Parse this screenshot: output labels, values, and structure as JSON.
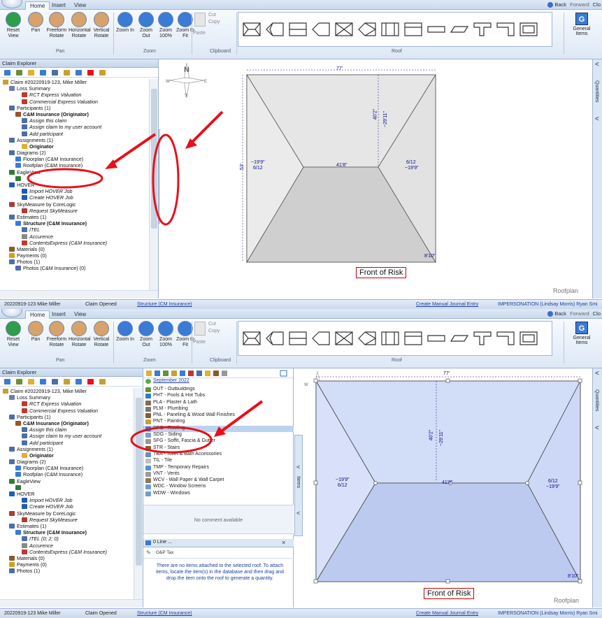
{
  "ribbon": {
    "tabs": [
      "Home",
      "Insert",
      "View"
    ],
    "top_right": {
      "back": "Back",
      "forward": "Forward",
      "close": "Clo"
    },
    "buttons": [
      {
        "label": "Reset View"
      },
      {
        "label": "Pan"
      },
      {
        "label": "Freeform Rotate"
      },
      {
        "label": "Horizontal Rotate"
      },
      {
        "label": "Vertical Rotate"
      },
      {
        "label": "Zoom In"
      },
      {
        "label": "Zoom Out"
      },
      {
        "label": "Zoom 100%"
      },
      {
        "label": "Zoom to Fit"
      }
    ],
    "clipboard": {
      "paste": "Paste",
      "cut": "Cut",
      "copy": "Copy"
    },
    "groups": {
      "pan": "Pan",
      "zoom": "Zoom",
      "clipboard": "Clipboard",
      "roof": "Roof"
    },
    "general_items": "General Items"
  },
  "explorer": {
    "title": "Claim Explorer",
    "claim": "Claim #20220919-123, Mike Miller",
    "nodes1": [
      {
        "t": "Claim #20220919-123, Mike Miller",
        "lvl": 0,
        "c": "#c8a032",
        "s": ""
      },
      {
        "t": "Loss Summary",
        "lvl": 1,
        "c": "#6a7db0",
        "s": ""
      },
      {
        "t": "RCT Express Valuation",
        "lvl": 3,
        "c": "#c0392b",
        "s": "ital"
      },
      {
        "t": "Commercial Express Valuation",
        "lvl": 3,
        "c": "#c0392b",
        "s": "ital"
      },
      {
        "t": "Participants (1)",
        "lvl": 1,
        "c": "#4a6fa8",
        "s": ""
      },
      {
        "t": "C&M Insurance (Originator)",
        "lvl": 2,
        "c": "#a0522d",
        "s": "bold"
      },
      {
        "t": "Assign this claim",
        "lvl": 3,
        "c": "#4a6fa8",
        "s": "ital"
      },
      {
        "t": "Assign claim to my user account",
        "lvl": 3,
        "c": "#4a6fa8",
        "s": "ital"
      },
      {
        "t": "Add participant",
        "lvl": 3,
        "c": "#4a6fa8",
        "s": "ital"
      },
      {
        "t": "Assignments (1)",
        "lvl": 1,
        "c": "#4a6fa8",
        "s": ""
      },
      {
        "t": "Originator",
        "lvl": 3,
        "c": "#e0b030",
        "s": "bold"
      },
      {
        "t": "Diagrams (2)",
        "lvl": 1,
        "c": "#4a6fa8",
        "s": ""
      },
      {
        "t": "Floorplan (C&M Insurance)",
        "lvl": 2,
        "c": "#3a7bd5",
        "s": ""
      },
      {
        "t": "Roofplan (C&M Insurance)",
        "lvl": 2,
        "c": "#3a7bd5",
        "s": ""
      },
      {
        "t": "EagleView",
        "lvl": 1,
        "c": "#2e7d32",
        "s": ""
      },
      {
        "t": "",
        "lvl": 2,
        "c": "#2e7d32",
        "s": ""
      },
      {
        "t": "HOVER",
        "lvl": 1,
        "c": "#1e5bb8",
        "s": ""
      },
      {
        "t": "Import HOVER Job",
        "lvl": 3,
        "c": "#1e5bb8",
        "s": "ital"
      },
      {
        "t": "Create HOVER Job",
        "lvl": 3,
        "c": "#1e5bb8",
        "s": "ital"
      },
      {
        "t": "SkyMeasure by CoreLogic",
        "lvl": 1,
        "c": "#b03a2e",
        "s": ""
      },
      {
        "t": "Request SkyMeasure",
        "lvl": 3,
        "c": "#b03a2e",
        "s": "ital"
      },
      {
        "t": "Estimates (1)",
        "lvl": 1,
        "c": "#4a6fa8",
        "s": ""
      },
      {
        "t": "Structure (C&M Insurance)",
        "lvl": 2,
        "c": "#3a7bd5",
        "s": "bold"
      },
      {
        "t": "ITEL",
        "lvl": 3,
        "c": "#4a6fa8",
        "s": "ital"
      },
      {
        "t": "Accurence",
        "lvl": 3,
        "c": "#888888",
        "s": "ital"
      },
      {
        "t": "ContentsExpress (C&M Insurance)",
        "lvl": 3,
        "c": "#c0392b",
        "s": "ital"
      },
      {
        "t": "Materials (0)",
        "lvl": 1,
        "c": "#8b5a2b",
        "s": ""
      },
      {
        "t": "Payments (0)",
        "lvl": 1,
        "c": "#d4a017",
        "s": ""
      },
      {
        "t": "Photos (1)",
        "lvl": 1,
        "c": "#4a6fa8",
        "s": ""
      },
      {
        "t": "Photos (C&M Insurance) (0)",
        "lvl": 2,
        "c": "#4a6fa8",
        "s": ""
      }
    ],
    "nodes2": [
      {
        "t": "Claim #20220919-123, Mike Miller",
        "lvl": 0,
        "c": "#c8a032",
        "s": ""
      },
      {
        "t": "Loss Summary",
        "lvl": 1,
        "c": "#6a7db0",
        "s": ""
      },
      {
        "t": "RCT Express Valuation",
        "lvl": 3,
        "c": "#c0392b",
        "s": "ital"
      },
      {
        "t": "Commercial Express Valuation",
        "lvl": 3,
        "c": "#c0392b",
        "s": "ital"
      },
      {
        "t": "Participants (1)",
        "lvl": 1,
        "c": "#4a6fa8",
        "s": ""
      },
      {
        "t": "C&M Insurance (Originator)",
        "lvl": 2,
        "c": "#a0522d",
        "s": "bold"
      },
      {
        "t": "Assign this claim",
        "lvl": 3,
        "c": "#4a6fa8",
        "s": "ital"
      },
      {
        "t": "Assign claim to my user account",
        "lvl": 3,
        "c": "#4a6fa8",
        "s": "ital"
      },
      {
        "t": "Add participant",
        "lvl": 3,
        "c": "#4a6fa8",
        "s": "ital"
      },
      {
        "t": "Assignments (1)",
        "lvl": 1,
        "c": "#4a6fa8",
        "s": ""
      },
      {
        "t": "Originator",
        "lvl": 3,
        "c": "#e0b030",
        "s": "bold"
      },
      {
        "t": "Diagrams (2)",
        "lvl": 1,
        "c": "#4a6fa8",
        "s": ""
      },
      {
        "t": "Floorplan (C&M Insurance)",
        "lvl": 2,
        "c": "#3a7bd5",
        "s": ""
      },
      {
        "t": "Roofplan (C&M Insurance)",
        "lvl": 2,
        "c": "#3a7bd5",
        "s": ""
      },
      {
        "t": "EagleView",
        "lvl": 1,
        "c": "#2e7d32",
        "s": ""
      },
      {
        "t": "",
        "lvl": 2,
        "c": "#2e7d32",
        "s": ""
      },
      {
        "t": "HOVER",
        "lvl": 1,
        "c": "#1e5bb8",
        "s": ""
      },
      {
        "t": "Import HOVER Job",
        "lvl": 3,
        "c": "#1e5bb8",
        "s": "ital"
      },
      {
        "t": "Create HOVER Job",
        "lvl": 3,
        "c": "#1e5bb8",
        "s": "ital"
      },
      {
        "t": "SkyMeasure by CoreLogic",
        "lvl": 1,
        "c": "#b03a2e",
        "s": ""
      },
      {
        "t": "Request SkyMeasure",
        "lvl": 3,
        "c": "#b03a2e",
        "s": "ital"
      },
      {
        "t": "Estimates (1)",
        "lvl": 1,
        "c": "#4a6fa8",
        "s": ""
      },
      {
        "t": "Structure (C&M Insurance)",
        "lvl": 2,
        "c": "#3a7bd5",
        "s": "bold"
      },
      {
        "t": "ITEL (0; 2; 0)",
        "lvl": 3,
        "c": "#4a6fa8",
        "s": "ital"
      },
      {
        "t": "Accurence",
        "lvl": 3,
        "c": "#888888",
        "s": "ital"
      },
      {
        "t": "ContentsExpress (C&M Insurance)",
        "lvl": 3,
        "c": "#c0392b",
        "s": "ital"
      },
      {
        "t": "Materials (0)",
        "lvl": 1,
        "c": "#8b5a2b",
        "s": ""
      },
      {
        "t": "Payments (0)",
        "lvl": 1,
        "c": "#d4a017",
        "s": ""
      },
      {
        "t": "Photos (1)",
        "lvl": 1,
        "c": "#4a6fa8",
        "s": ""
      }
    ]
  },
  "side_tabs": {
    "items": "Items",
    "quantities": "Quantities"
  },
  "roof": {
    "width": "77'",
    "depth": "53'",
    "ridge": "41'8\"",
    "hip_top": "40'2\"",
    "hip_top2": "~29'11\"",
    "left_pitch": "6/12",
    "left_len": "~19'9\"",
    "right_pitch": "6/12",
    "right_len": "~19'9\"",
    "corner": "8'10\"",
    "front": "Front of Risk",
    "label": "Roofplan"
  },
  "status": {
    "claim": "20220919-123 Mike Miller",
    "opened": "Claim Opened",
    "structure": "Structure (CM Insurance)",
    "journal": "Create Manual Journal Entry",
    "impersonation": "IMPERSONATION (Lindsay Morris) Ryan Smi"
  },
  "items_panel": {
    "price_list": "September 2022",
    "rows": [
      {
        "t": "OUT - Outbuildings",
        "c": "#6a8f3a"
      },
      {
        "t": "PHT - Pools & Hot Tubs",
        "c": "#2a7fc0"
      },
      {
        "t": "PLA - Plaster & Lath",
        "c": "#8a6a4a"
      },
      {
        "t": "PLM - Plumbing",
        "c": "#777777"
      },
      {
        "t": "PNL - Paneling & Wood Wall Finishes",
        "c": "#8b5a2b"
      },
      {
        "t": "PNT - Painting",
        "c": "#c8a032"
      },
      {
        "t": "RFG - Roofing",
        "c": "#3a7bd5"
      },
      {
        "t": "SDG - Siding",
        "c": "#7aa0c8"
      },
      {
        "t": "SFG - Soffit, Fascia & Gutter",
        "c": "#999999"
      },
      {
        "t": "STR - Stairs",
        "c": "#8b5a2b"
      },
      {
        "t": "TBA - Toilet & Bath Accessories",
        "c": "#6a8fc0"
      },
      {
        "t": "TIL - Tile",
        "c": "#c0c0c0"
      },
      {
        "t": "TMP - Temporary Repairs",
        "c": "#5a8fd5"
      },
      {
        "t": "VNT - Vents",
        "c": "#9a9a9a"
      },
      {
        "t": "WCV - Wall Paper & Wall Carpet",
        "c": "#8a7a5a"
      },
      {
        "t": "WDC - Window Screens",
        "c": "#6a9fd5"
      },
      {
        "t": "WDW - Windows",
        "c": "#6a9fd5"
      }
    ],
    "selected_index": 6,
    "no_comment": "No comment available",
    "line_items": "0 Line ...",
    "line_tool": "O&P  Tax",
    "empty_msg": "There are no items attached to the selected roof. To attach items, locate the item(s) in the database and then drag and drop the item onto the roof to generate a quantity."
  },
  "compass": {
    "n": "N",
    "s": "S",
    "e": "E",
    "w": "W"
  },
  "colors": {
    "roof_fill1": "#e6e6e6",
    "roof_fill2": "#c5d3f5",
    "highlight": "#e8101a",
    "annotation": "#e8101a"
  }
}
